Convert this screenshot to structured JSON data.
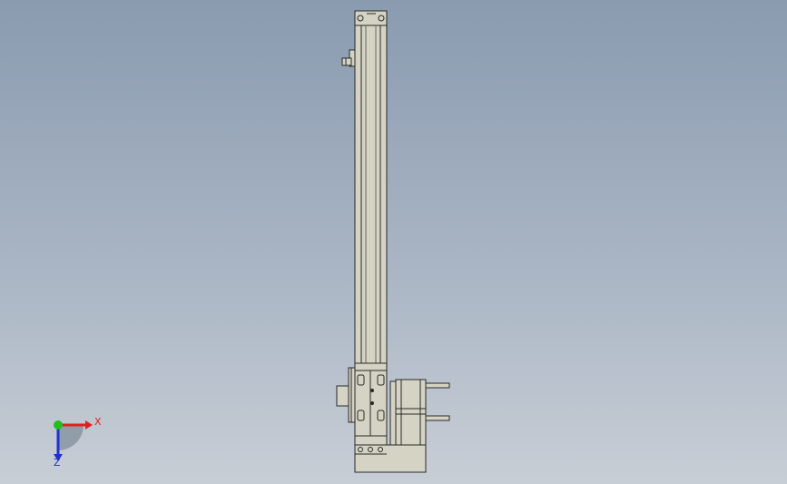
{
  "viewport": {
    "background_top": "#8a9bb0",
    "background_bottom": "#c8ced6"
  },
  "triad": {
    "x_label": "X",
    "z_label": "Z",
    "x_color": "#e02020",
    "y_color": "#20c020",
    "z_color": "#2030d0"
  },
  "model": {
    "body_color": "#d4d3c4",
    "edge_color": "#2a2a2a"
  }
}
